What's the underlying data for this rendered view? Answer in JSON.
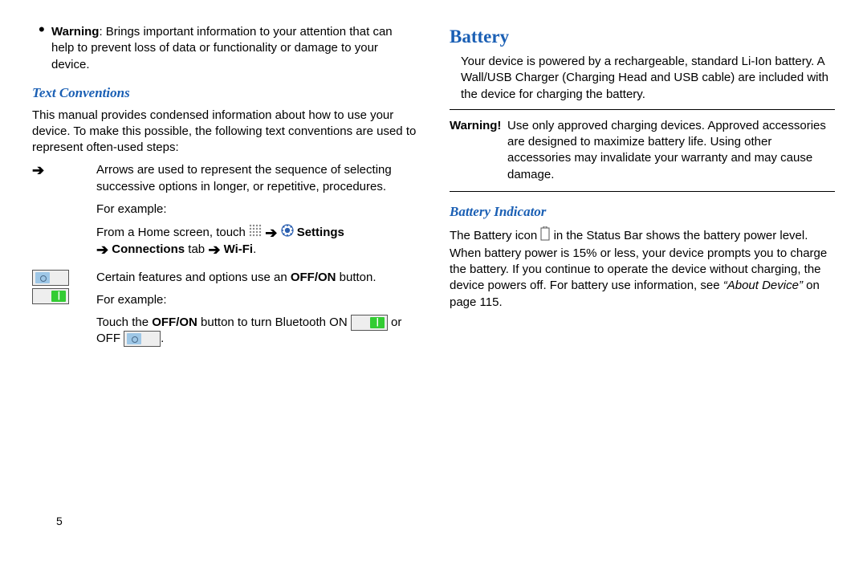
{
  "left": {
    "warning_bullet": {
      "label": "Warning",
      "text": ": Brings important information to your attention that can help to prevent loss of data or functionality or damage to your device."
    },
    "heading": "Text Conventions",
    "intro": "This manual provides condensed information about how to use your device. To make this possible, the following text conventions are used to represent often-used steps:",
    "arrow_row": {
      "desc": "Arrows are used to represent the sequence of selecting successive options in longer, or repetitive, procedures.",
      "for_example": "For example:",
      "ex_line_pre": "From a Home screen, touch ",
      "ex_settings": " Settings",
      "ex_connections_pre": " Connections",
      "ex_tab": " tab ",
      "ex_wifi": " Wi-Fi",
      "period": "."
    },
    "toggle_row": {
      "desc_pre": "Certain features and options use an ",
      "off_on": "OFF/ON",
      "desc_post": " button.",
      "for_example": "For example:",
      "ex_pre": "Touch the ",
      "ex_off_on": "OFF/ON",
      "ex_mid": " button to turn Bluetooth ON ",
      "ex_or": " or OFF ",
      "period": "."
    }
  },
  "right": {
    "heading": "Battery",
    "intro": "Your device is powered by a rechargeable, standard Li-Ion battery. A Wall/USB Charger (Charging Head and USB cable) are included with the device for charging the battery.",
    "warning": {
      "label": "Warning!",
      "text": "Use only approved charging devices. Approved accessories are designed to maximize battery life. Using other accessories may invalidate your warranty and may cause damage."
    },
    "sub_heading": "Battery Indicator",
    "indicator_pre": "The Battery icon ",
    "indicator_mid": " in the Status Bar shows the battery power level. When battery power is 15% or less, your device prompts you to charge the battery. If you continue to operate the device without charging, the device powers off. For battery use information, see ",
    "about_device": "“About Device”",
    "indicator_post": " on page 115."
  },
  "page_number": "5"
}
